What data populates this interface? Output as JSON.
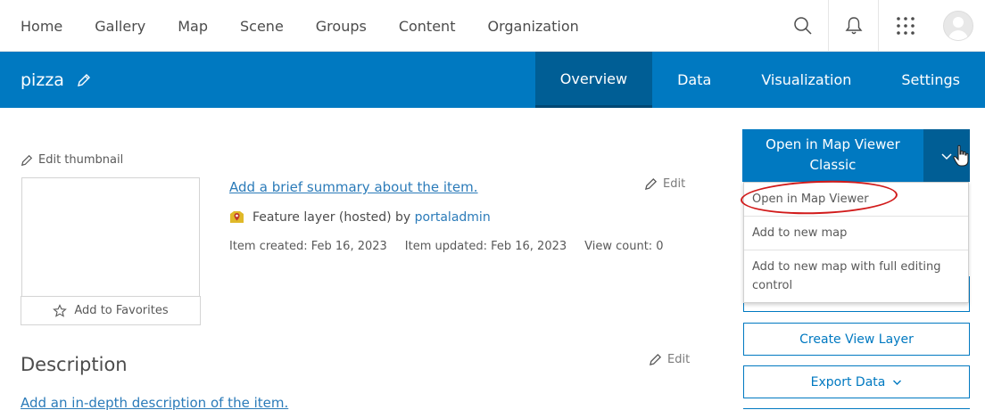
{
  "topnav": {
    "links": [
      "Home",
      "Gallery",
      "Map",
      "Scene",
      "Groups",
      "Content",
      "Organization"
    ],
    "icons": [
      "search-icon",
      "bell-icon",
      "app-launcher-icon",
      "avatar"
    ]
  },
  "item": {
    "title": "pizza",
    "tabs": [
      "Overview",
      "Data",
      "Visualization",
      "Settings"
    ],
    "active_tab": "Overview"
  },
  "thumbnail": {
    "edit_label": "Edit thumbnail",
    "favorites_label": "Add to Favorites"
  },
  "details": {
    "summary_link": "Add a brief summary about the item.",
    "edit_label": "Edit",
    "type_text": "Feature layer (hosted) by",
    "owner": "portaladmin",
    "created": "Item created: Feb 16, 2023",
    "updated": "Item updated: Feb 16, 2023",
    "views": "View count: 0"
  },
  "description": {
    "heading": "Description",
    "edit_label": "Edit",
    "link": "Add an in-depth description of the item."
  },
  "actions": {
    "open_button_line1": "Open in Map Viewer",
    "open_button_line2": "Classic",
    "menu_items": [
      "Open in Map Viewer",
      "Add to new map",
      "Add to new map with full editing control"
    ],
    "create_view_layer": "Create View Layer",
    "export_data": "Export Data"
  },
  "colors": {
    "brand_blue": "#0079c1",
    "active_tab": "#005e95",
    "link": "#2b7bb9",
    "annotation_red": "#d11a1a"
  }
}
